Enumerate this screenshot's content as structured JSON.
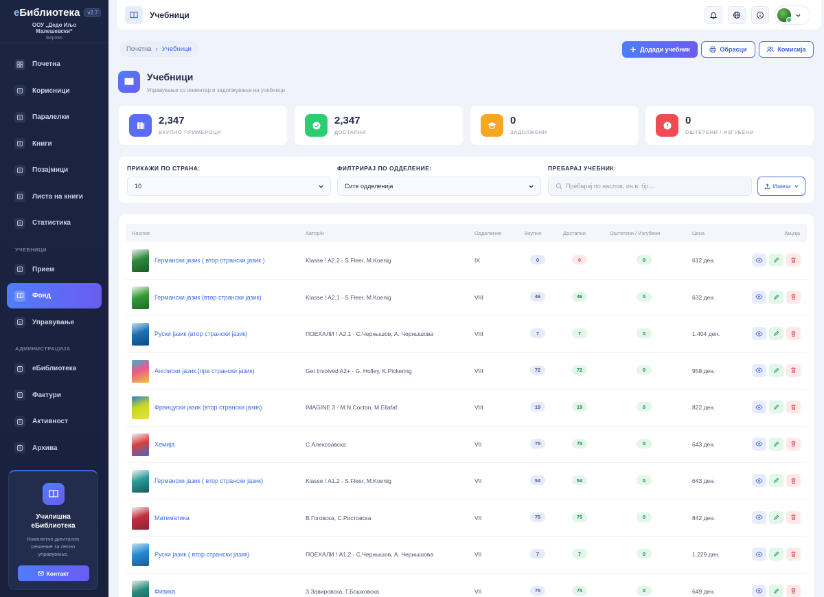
{
  "sidebar": {
    "brand_e": "е",
    "brand_rest": "Библиотека",
    "version": "v2.7",
    "school": "ООУ „Дедо Иљо Малешевски“",
    "city": "Берово",
    "items": [
      {
        "label": "Почетна",
        "icon": "grid-icon"
      },
      {
        "label": "Корисници",
        "icon": "users-icon"
      },
      {
        "label": "Паралелки",
        "icon": "chat-icon"
      },
      {
        "label": "Книги",
        "icon": "books-icon"
      },
      {
        "label": "Позајмици",
        "icon": "list-icon"
      },
      {
        "label": "Листа на книги",
        "icon": "list-lines-icon"
      },
      {
        "label": "Статистика",
        "icon": "chart-icon"
      }
    ],
    "section_textbooks": "УЧЕБНИЦИ",
    "textbook_items": [
      {
        "label": "Прием",
        "icon": "truck-icon"
      },
      {
        "label": "Фонд",
        "icon": "book-open-icon",
        "active": true
      },
      {
        "label": "Управување",
        "icon": "clipboard-icon"
      }
    ],
    "section_admin": "АДМИНИСТРАЦИЈА",
    "admin_items": [
      {
        "label": "еБиблиотека",
        "icon": "gear-icon"
      },
      {
        "label": "Фактури",
        "icon": "invoice-icon"
      },
      {
        "label": "Активност",
        "icon": "activity-icon"
      },
      {
        "label": "Архива",
        "icon": "archive-icon"
      }
    ],
    "promo": {
      "title_line1": "Училишна",
      "title_line2": "еБиблиотека",
      "text_line1": "Комплетно дигитално",
      "text_line2": "решение за лесно",
      "text_line3": "управување.",
      "button": "Контакт"
    }
  },
  "topbar": {
    "title": "Учебници"
  },
  "breadcrumb": {
    "home": "Почетна",
    "current": "Учебници"
  },
  "actions": {
    "add": "Додади учебник",
    "forms": "Обрасци",
    "commission": "Комисија"
  },
  "page": {
    "title": "Учебници",
    "subtitle": "Управување со инвентар и задолжување на учебници"
  },
  "stats": [
    {
      "value": "2,347",
      "label": "ВКУПНО ПРИМЕРОЦИ",
      "color": "#5b6cf5"
    },
    {
      "value": "2,347",
      "label": "ДОСТАПНИ",
      "color": "#2ecc71"
    },
    {
      "value": "0",
      "label": "ЗАДОЛЖЕНИ",
      "color": "#f5a623"
    },
    {
      "value": "0",
      "label": "ОШТЕТЕНИ / ИЗГУБЕНИ",
      "color": "#ef4b52"
    }
  ],
  "filters": {
    "per_page_label": "ПРИКАЖИ ПО СТРАНА:",
    "per_page_value": "10",
    "grade_label": "ФИЛТРИРАЈ ПО ОДДЕЛЕНИЕ:",
    "grade_value": "Сите одделенија",
    "search_label": "ПРЕБАРАЈ УЧЕБНИК:",
    "search_placeholder": "Пребарај по наслов, ин.в. бр....",
    "export": "Извези"
  },
  "table": {
    "headers": [
      "Наслов",
      "Автор/и",
      "Одделение",
      "Вкупно",
      "Достапни",
      "Оштетени / Изгубени",
      "Цена",
      "Акција"
    ],
    "rows": [
      {
        "title": "Германски јазик ( втор странски јазик )",
        "author": "Klasse ! A2.2 - S.Fleer, M.Koenig",
        "grade": "IX",
        "total": "0",
        "available": "0",
        "damaged": "0",
        "price": "612 ден.",
        "cover": [
          "#2e8a3e",
          "#e8f0e8",
          "#1a5a2a"
        ]
      },
      {
        "title": "Германски јазик (втор странски јазик)",
        "author": "Klasse ! A2.1 - S.Fleer, M.Koenig",
        "grade": "VIII",
        "total": "46",
        "available": "46",
        "damaged": "0",
        "price": "632 ден.",
        "cover": [
          "#3a9a3a",
          "#eef6ee",
          "#1e6a2e"
        ]
      },
      {
        "title": "Руски јазик (втор странски јазик)",
        "author": "ПОЕХАЛИ ! A2.1 - С.Чернышов, А. Чернышова",
        "grade": "VIII",
        "total": "7",
        "available": "7",
        "damaged": "0",
        "price": "1.404 ден.",
        "cover": [
          "#1e6fb0",
          "#bfe0f5",
          "#0f4a80"
        ]
      },
      {
        "title": "Англиски јазик (прв странски јазик)",
        "author": "Get Involved A2+ - G. Holley, K.Pickering",
        "grade": "VIII",
        "total": "72",
        "available": "72",
        "damaged": "0",
        "price": "958 ден.",
        "cover": [
          "#e85a8a",
          "#3ab0d0",
          "#f0c040"
        ]
      },
      {
        "title": "Француски јазик (втор странски јазик)",
        "author": "IMAGINE 3 - M.N.Cocton, M.Ellafaf",
        "grade": "VIII",
        "total": "19",
        "available": "19",
        "damaged": "0",
        "price": "822 ден.",
        "cover": [
          "#c8d820",
          "#2a7ad0",
          "#e8e040"
        ]
      },
      {
        "title": "Хемија",
        "author": "С.Алексоавска",
        "grade": "VII",
        "total": "75",
        "available": "75",
        "damaged": "0",
        "price": "643 ден.",
        "cover": [
          "#d84040",
          "#f0f0f0",
          "#3a70c0"
        ]
      },
      {
        "title": "Германски јазик ( втор странски јазик)",
        "author": "Klasse ! A1.2 - S.Fleer, M.Koenig",
        "grade": "VII",
        "total": "54",
        "available": "54",
        "damaged": "0",
        "price": "643 ден.",
        "cover": [
          "#2a9a9a",
          "#eef6ee",
          "#1a5a5a"
        ]
      },
      {
        "title": "Математика",
        "author": "В.Гоговска, С.Ристовска",
        "grade": "VII",
        "total": "75",
        "available": "75",
        "damaged": "0",
        "price": "842 ден.",
        "cover": [
          "#c03040",
          "#f4f4f4",
          "#902030"
        ]
      },
      {
        "title": "Руски јазик ( втор странски јазик)",
        "author": "ПОЕХАЛИ ! A1.2 - С.Чернышов, А. Чернышова",
        "grade": "VII",
        "total": "7",
        "available": "7",
        "damaged": "0",
        "price": "1.229 ден.",
        "cover": [
          "#2a8ad0",
          "#bfe0f5",
          "#1a5a90"
        ]
      },
      {
        "title": "Физика",
        "author": "З.Завировска, Г.Бошковска",
        "grade": "VII",
        "total": "75",
        "available": "75",
        "damaged": "0",
        "price": "649 ден.",
        "cover": [
          "#2a8a7a",
          "#e0f0ea",
          "#1a5a5a"
        ]
      }
    ]
  }
}
